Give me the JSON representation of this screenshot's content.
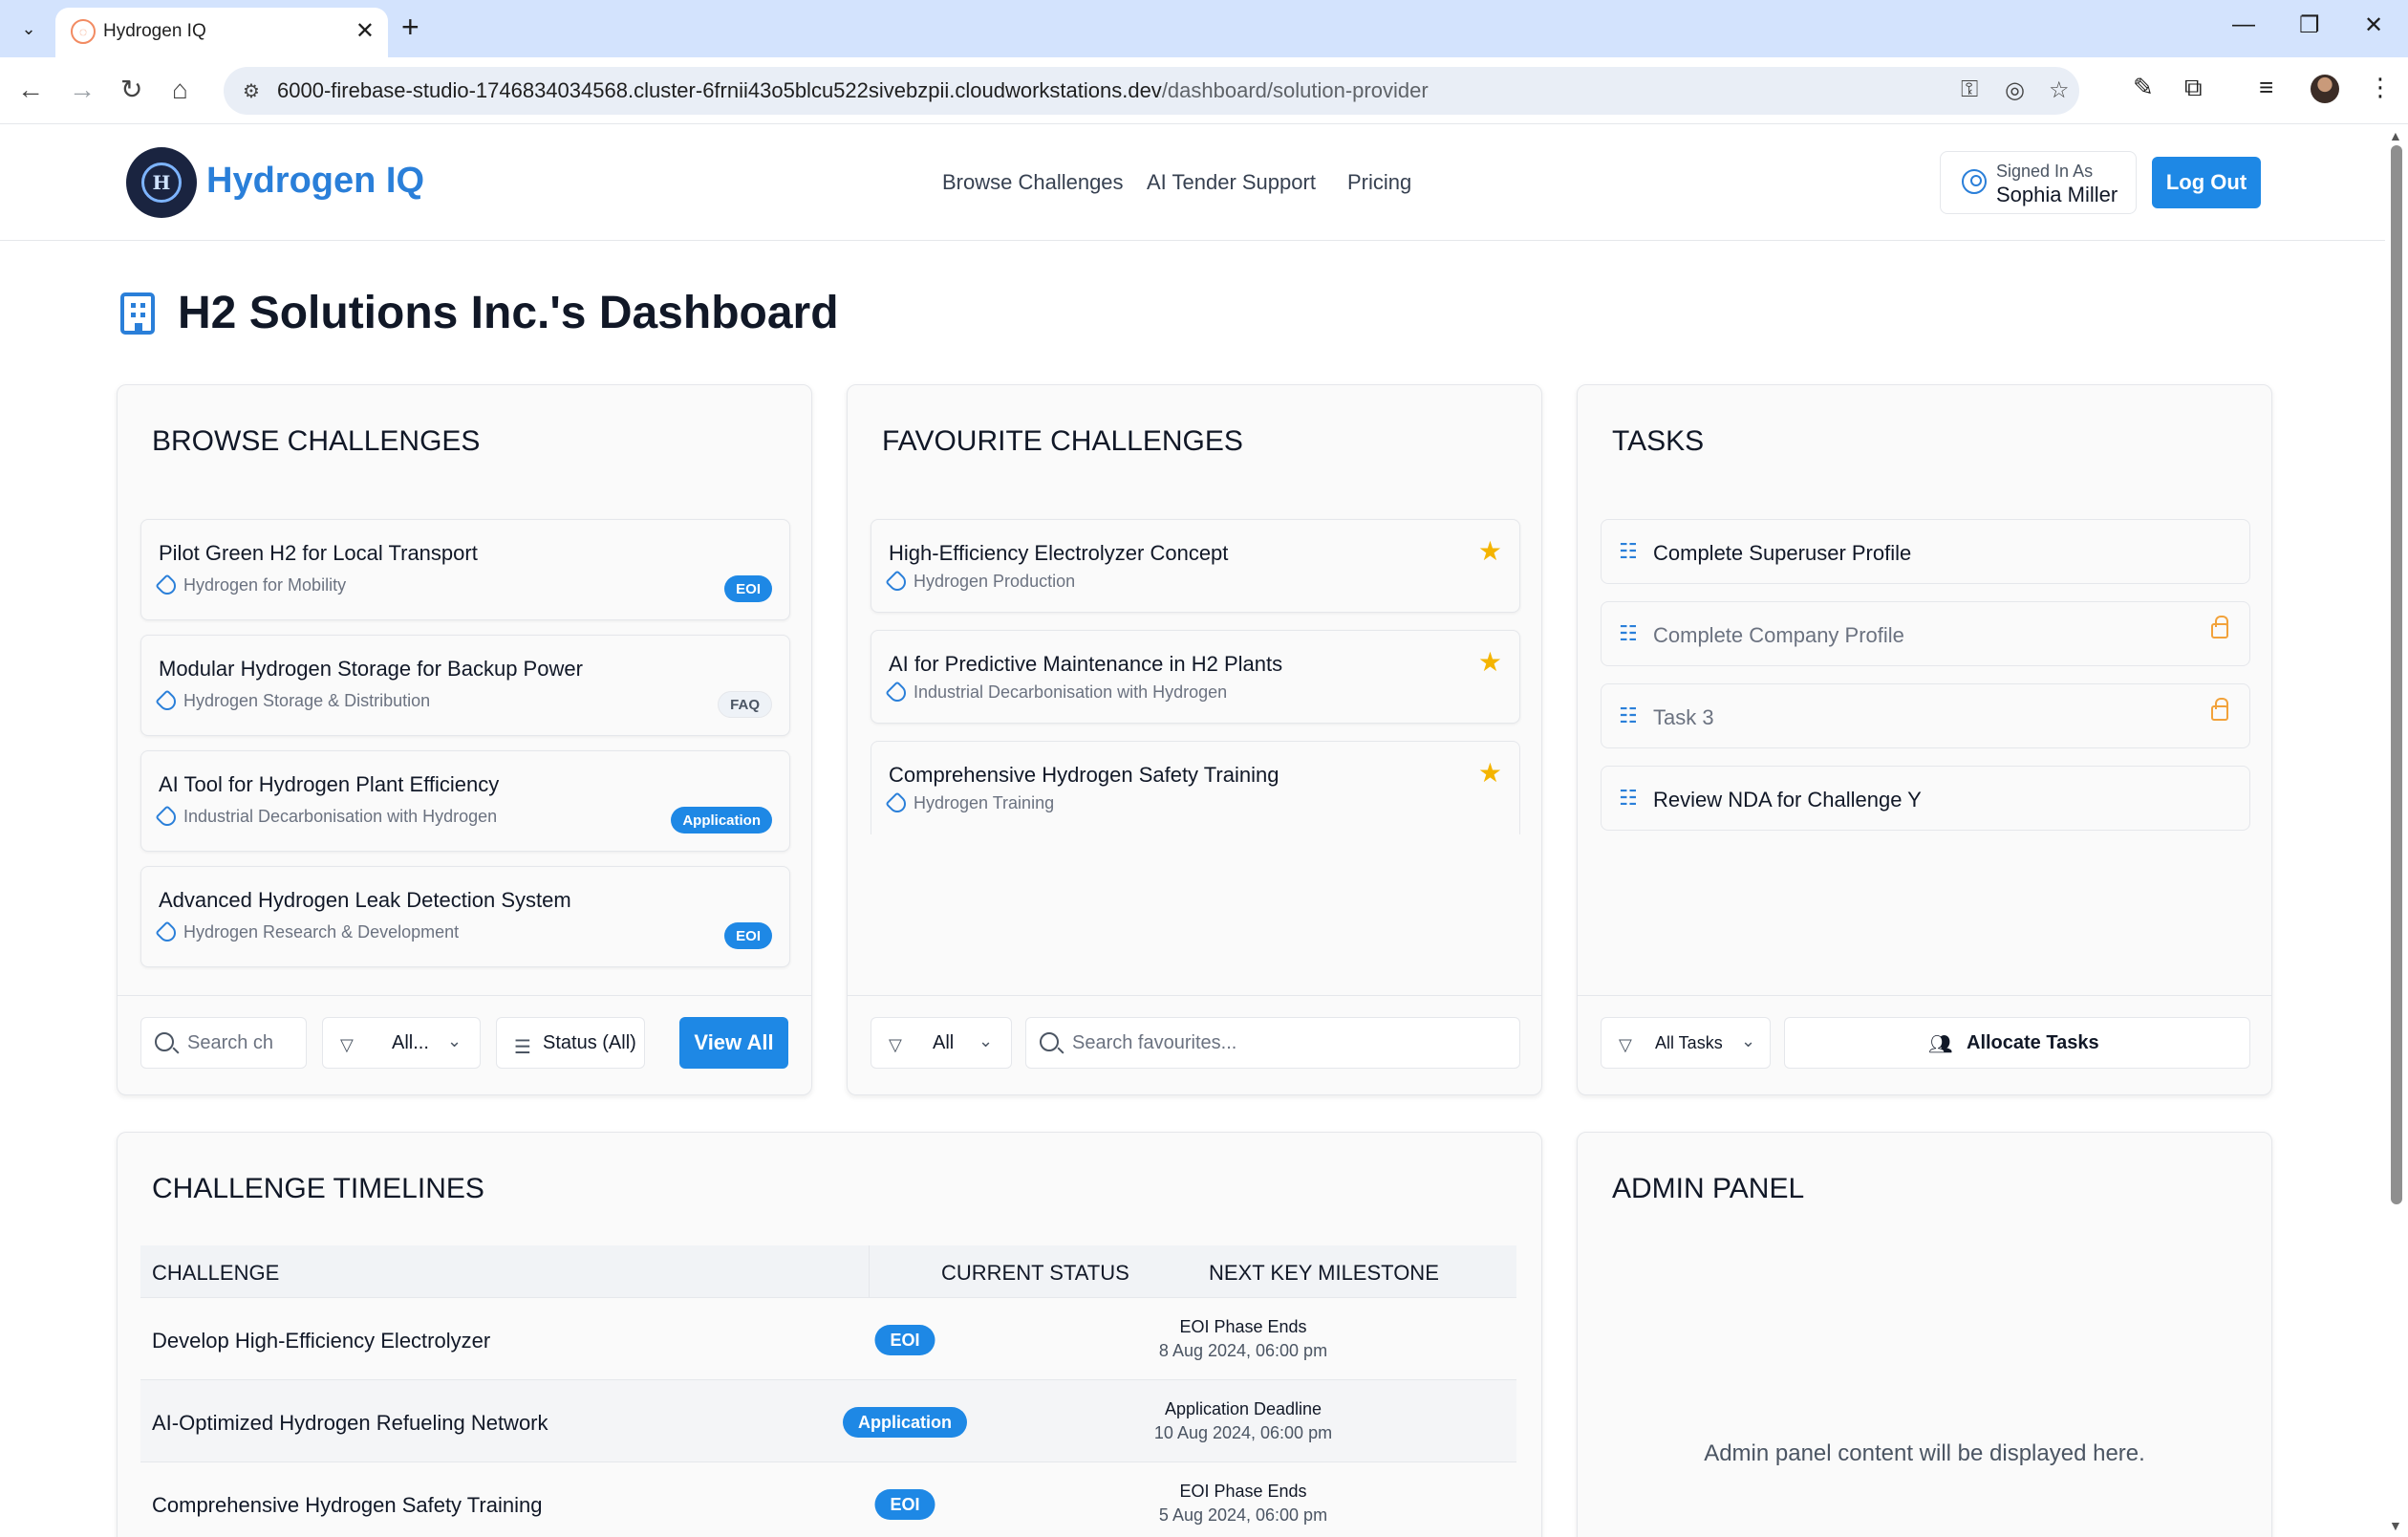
{
  "browser": {
    "tab_title": "Hydrogen IQ",
    "url_host": "6000-firebase-studio-1746834034568.cluster-6frnii43o5blcu522sivebzpii.cloudworkstations.dev",
    "url_path": "/dashboard/solution-provider"
  },
  "header": {
    "brand": "Hydrogen IQ",
    "logo_text": "H",
    "nav": [
      "Browse Challenges",
      "AI Tender Support",
      "Pricing"
    ],
    "signed_in_label": "Signed In As",
    "user_name": "Sophia Miller",
    "logout_label": "Log Out"
  },
  "page": {
    "title": "H2 Solutions Inc.'s Dashboard"
  },
  "browse": {
    "title": "BROWSE CHALLENGES",
    "items": [
      {
        "title": "Pilot Green H2 for Local Transport",
        "category": "Hydrogen for Mobility",
        "badge": "EOI",
        "badge_style": "blue"
      },
      {
        "title": "Modular Hydrogen Storage for Backup Power",
        "category": "Hydrogen Storage & Distribution",
        "badge": "FAQ",
        "badge_style": "gray"
      },
      {
        "title": "AI Tool for Hydrogen Plant Efficiency",
        "category": "Industrial Decarbonisation with Hydrogen",
        "badge": "Application",
        "badge_style": "blue"
      },
      {
        "title": "Advanced Hydrogen Leak Detection System",
        "category": "Hydrogen Research & Development",
        "badge": "EOI",
        "badge_style": "blue"
      }
    ],
    "search_placeholder": "Search ch",
    "filter_value": "All...",
    "status_label": "Status (All)",
    "view_all_label": "View All"
  },
  "favourites": {
    "title": "FAVOURITE CHALLENGES",
    "items": [
      {
        "title": "High-Efficiency Electrolyzer Concept",
        "category": "Hydrogen Production"
      },
      {
        "title": "AI for Predictive Maintenance in H2 Plants",
        "category": "Industrial Decarbonisation with Hydrogen"
      },
      {
        "title": "Comprehensive Hydrogen Safety Training",
        "category": "Hydrogen Training"
      }
    ],
    "filter_value": "All",
    "search_placeholder": "Search favourites..."
  },
  "tasks": {
    "title": "TASKS",
    "items": [
      {
        "label": "Complete Superuser Profile",
        "locked": false
      },
      {
        "label": "Complete Company Profile",
        "locked": true
      },
      {
        "label": "Task 3",
        "locked": true
      },
      {
        "label": "Review NDA for Challenge Y",
        "locked": false
      }
    ],
    "filter_value": "All Tasks",
    "allocate_label": "Allocate Tasks"
  },
  "timelines": {
    "title": "CHALLENGE TIMELINES",
    "columns": [
      "CHALLENGE",
      "CURRENT STATUS",
      "NEXT KEY MILESTONE"
    ],
    "rows": [
      {
        "challenge": "Develop High-Efficiency Electrolyzer",
        "status": "EOI",
        "milestone": "EOI Phase Ends",
        "date": "8 Aug 2024, 06:00 pm"
      },
      {
        "challenge": "AI-Optimized Hydrogen Refueling Network",
        "status": "Application",
        "milestone": "Application Deadline",
        "date": "10 Aug 2024, 06:00 pm"
      },
      {
        "challenge": "Comprehensive Hydrogen Safety Training",
        "status": "EOI",
        "milestone": "EOI Phase Ends",
        "date": "5 Aug 2024, 06:00 pm"
      }
    ]
  },
  "admin": {
    "title": "ADMIN PANEL",
    "message": "Admin panel content will be displayed here."
  },
  "colors": {
    "accent": "#1e88e5",
    "brand": "#2a7fd9",
    "star": "#f4b400",
    "lock": "#f2a23a"
  }
}
